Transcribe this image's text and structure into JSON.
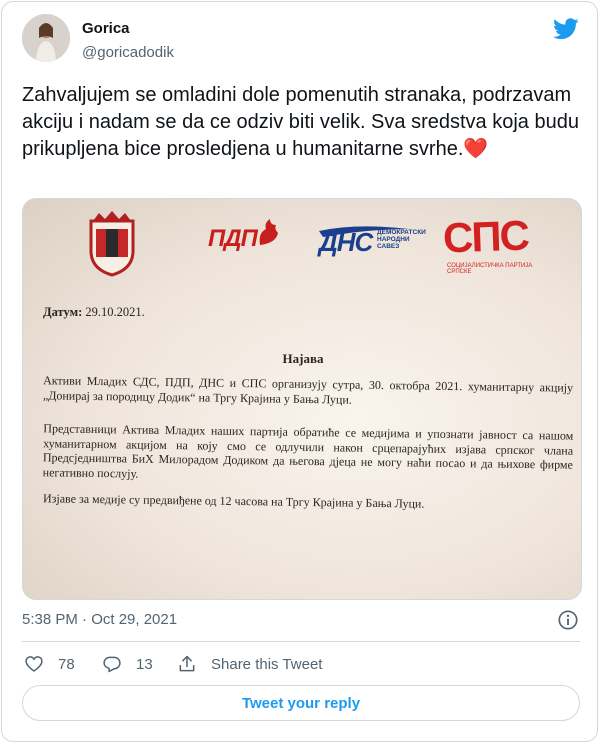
{
  "author": {
    "name": "Gorica",
    "handle": "@goricadodik"
  },
  "tweet": {
    "text": "Zahvaljujem se omladini dole pomenutih stranaka, podrzavam akciju i nadam se da ce odziv biti velik. Sva sredstva koja budu prikupljena bice prosledjena u humanitarne svrhe.",
    "emoji": "❤️",
    "timestamp": "5:38 PM · Oct 29, 2021"
  },
  "photo": {
    "logos": {
      "pdp": "ПДП",
      "dns": "ДНС",
      "dns_sub": "ДЕМОКРАТСКИ НАРОДНИ САВЕЗ",
      "sps": "СПС",
      "sps_sub": "СОЦИЈАЛИСТИЧКА ПАРТИЈА СРПСКЕ"
    },
    "date_label": "Датум:",
    "date_value": "29.10.2021.",
    "title": "Најава",
    "p1": "Активи Младих СДС, ПДП, ДНС и СПС организују сутра, 30. октобра 2021. хуманитарну акцију „Донирај за породицу Додик“ на Тргу Крајина у Бања Луци.",
    "p2": "Представници Актива Младих наших партија обратиће се медијима и упознати јавност са нашом хуманитарном акцијом на коју смо се одлучили након срцепарајућих изјава српског члана Предсједништва БиХ Милорадом Додиком да његова дјеца не могу наћи посао и да њихове фирме негативно послују.",
    "p3": "Изјаве за медије су предвиђене од 12 часова на Тргу Крајина у Бања Луци."
  },
  "actions": {
    "likes": "78",
    "replies": "13",
    "share_label": "Share this Tweet",
    "reply_button": "Tweet your reply"
  },
  "icons": {
    "brand": "twitter-bird-icon",
    "like": "heart-icon",
    "reply": "reply-bubble-icon",
    "share": "share-upload-icon",
    "info": "info-icon"
  },
  "colors": {
    "twitter_blue": "#1d9bf0",
    "muted": "#536471",
    "heart": "#e0245e"
  }
}
